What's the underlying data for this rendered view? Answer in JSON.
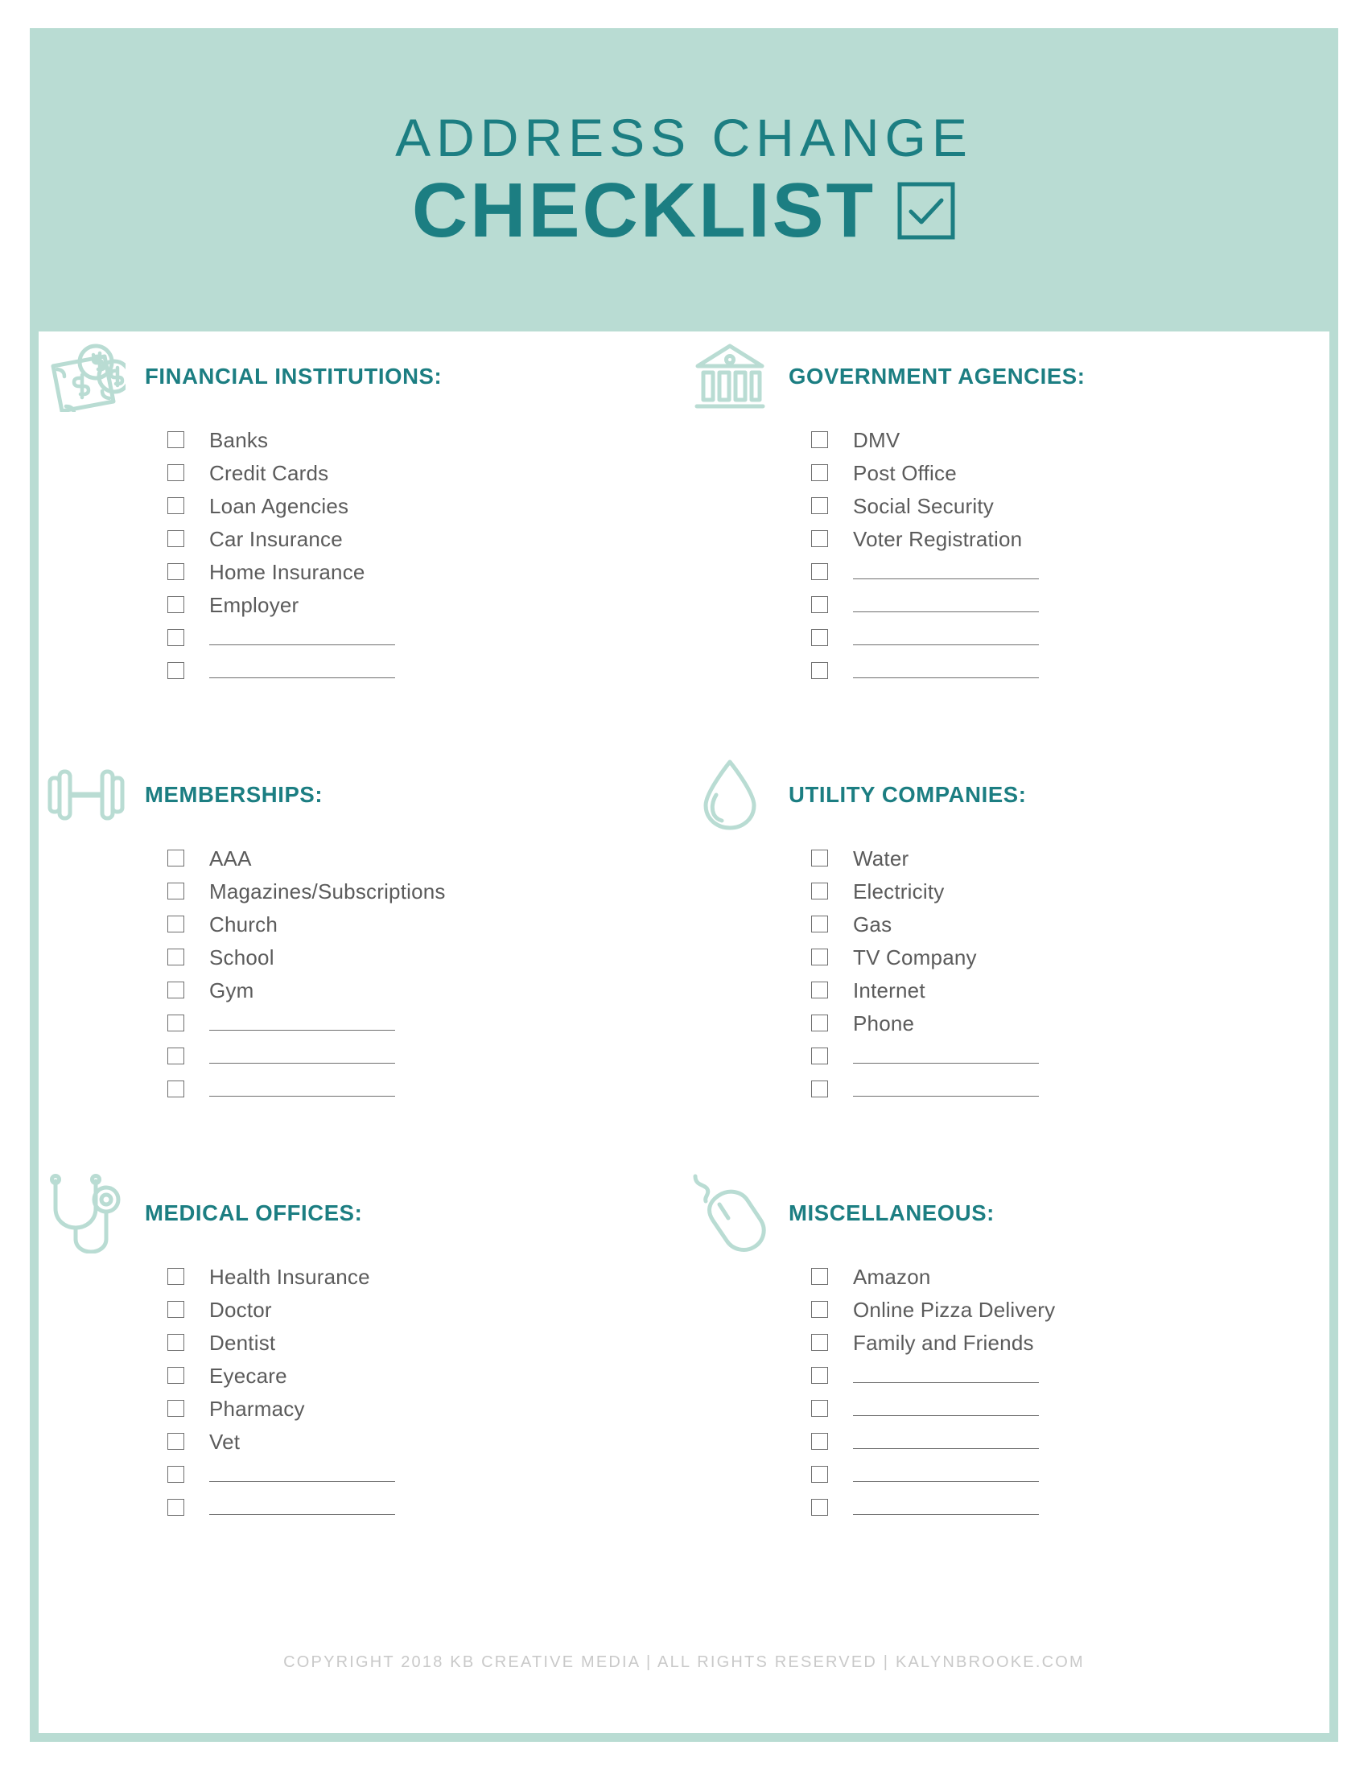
{
  "header": {
    "title_line1": "ADDRESS CHANGE",
    "title_line2": "CHECKLIST",
    "check_icon": "checkbox-checked-icon"
  },
  "theme": {
    "mint": "#b9dcd3",
    "teal": "#1c7e82",
    "text_gray": "#5b5b5b",
    "box_gray": "#6e6e6e",
    "footer_gray": "#c9c9c9"
  },
  "sections": [
    {
      "id": "financial-institutions",
      "title": "FINANCIAL INSTITUTIONS:",
      "icon": "money-icon",
      "items": [
        "Banks",
        "Credit Cards",
        "Loan Agencies",
        "Car Insurance",
        "Home Insurance",
        "Employer"
      ],
      "blank_lines": 2
    },
    {
      "id": "government-agencies",
      "title": "GOVERNMENT AGENCIES:",
      "icon": "bank-building-icon",
      "items": [
        "DMV",
        "Post Office",
        "Social Security",
        "Voter Registration"
      ],
      "blank_lines": 4
    },
    {
      "id": "memberships",
      "title": "MEMBERSHIPS:",
      "icon": "dumbbell-icon",
      "items": [
        "AAA",
        "Magazines/Subscriptions",
        "Church",
        "School",
        "Gym"
      ],
      "blank_lines": 3
    },
    {
      "id": "utility-companies",
      "title": "UTILITY COMPANIES:",
      "icon": "water-drop-icon",
      "items": [
        "Water",
        "Electricity",
        "Gas",
        "TV Company",
        "Internet",
        "Phone"
      ],
      "blank_lines": 2
    },
    {
      "id": "medical-offices",
      "title": "MEDICAL OFFICES:",
      "icon": "stethoscope-icon",
      "items": [
        "Health Insurance",
        "Doctor",
        "Dentist",
        "Eyecare",
        "Pharmacy",
        "Vet"
      ],
      "blank_lines": 2
    },
    {
      "id": "miscellaneous",
      "title": "MISCELLANEOUS:",
      "icon": "computer-mouse-icon",
      "items": [
        "Amazon",
        "Online Pizza Delivery",
        "Family and Friends"
      ],
      "blank_lines": 5
    }
  ],
  "footer": {
    "text": "COPYRIGHT 2018 KB CREATIVE MEDIA  |  ALL RIGHTS RESERVED  |  KALYNBROOKE.COM"
  }
}
